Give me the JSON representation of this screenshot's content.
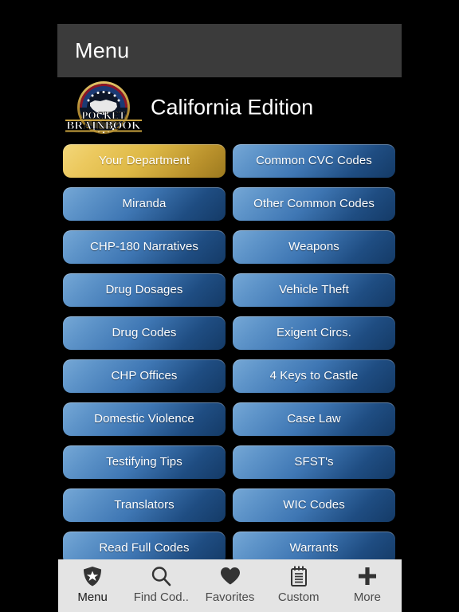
{
  "navbar": {
    "title": "Menu"
  },
  "brand": {
    "logo_icon": "pocket-brainbook-badge-logo",
    "logo_text_top": "POCKET",
    "logo_text_bottom": "BRAINBOOK",
    "edition_title": "California Edition"
  },
  "menu": {
    "rows": [
      {
        "left": {
          "label": "Your Department",
          "style": "gold"
        },
        "right": {
          "label": "Common CVC Codes",
          "style": "blue"
        }
      },
      {
        "left": {
          "label": "Miranda",
          "style": "blue"
        },
        "right": {
          "label": "Other Common Codes",
          "style": "blue"
        }
      },
      {
        "left": {
          "label": "CHP-180 Narratives",
          "style": "blue"
        },
        "right": {
          "label": "Weapons",
          "style": "blue"
        }
      },
      {
        "left": {
          "label": "Drug Dosages",
          "style": "blue"
        },
        "right": {
          "label": "Vehicle Theft",
          "style": "blue"
        }
      },
      {
        "left": {
          "label": "Drug Codes",
          "style": "blue"
        },
        "right": {
          "label": "Exigent Circs.",
          "style": "blue"
        }
      },
      {
        "left": {
          "label": "CHP Offices",
          "style": "blue"
        },
        "right": {
          "label": "4 Keys to Castle",
          "style": "blue"
        }
      },
      {
        "left": {
          "label": "Domestic Violence",
          "style": "blue"
        },
        "right": {
          "label": "Case Law",
          "style": "blue"
        }
      },
      {
        "left": {
          "label": "Testifying Tips",
          "style": "blue"
        },
        "right": {
          "label": "SFST's",
          "style": "blue"
        }
      },
      {
        "left": {
          "label": "Translators",
          "style": "blue"
        },
        "right": {
          "label": "WIC Codes",
          "style": "blue"
        }
      },
      {
        "left": {
          "label": "Read Full Codes",
          "style": "blue"
        },
        "right": {
          "label": "Warrants",
          "style": "blue"
        }
      }
    ]
  },
  "tabbar": {
    "items": [
      {
        "label": "Menu",
        "icon": "shield-star-icon",
        "active": true
      },
      {
        "label": "Find Cod..",
        "icon": "search-icon",
        "active": false
      },
      {
        "label": "Favorites",
        "icon": "heart-icon",
        "active": false
      },
      {
        "label": "Custom",
        "icon": "notepad-icon",
        "active": false
      },
      {
        "label": "More",
        "icon": "plus-icon",
        "active": false
      }
    ]
  },
  "colors": {
    "background": "#000000",
    "navbar": "#3b3b3b",
    "button_blue_light": "#76a8d6",
    "button_blue_dark": "#143a66",
    "button_gold_light": "#f2d77a",
    "button_gold_dark": "#9c7a1f",
    "tabbar": "#e4e4e4",
    "tab_icon": "#333333"
  }
}
